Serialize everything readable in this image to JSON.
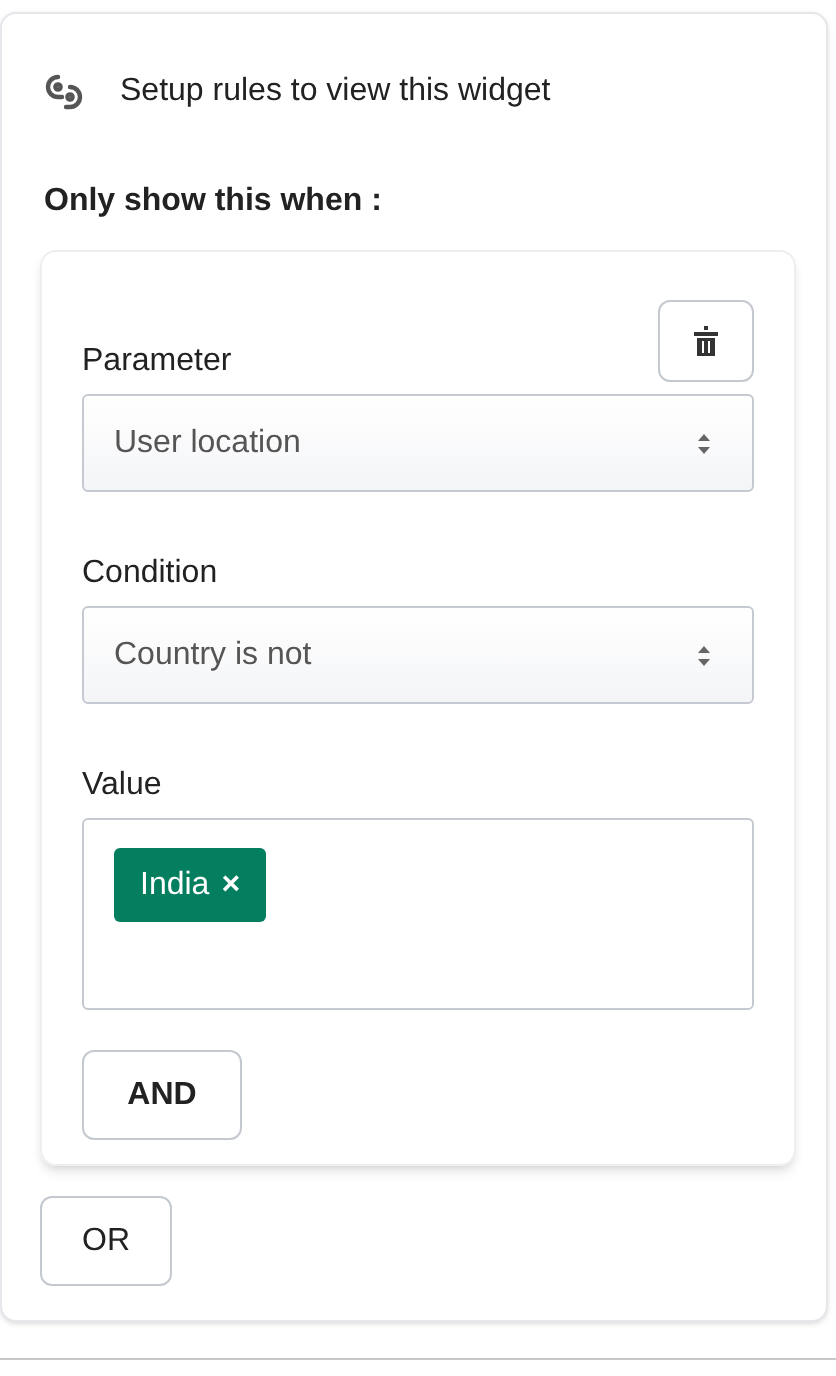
{
  "header": {
    "title": "Setup rules to view this widget"
  },
  "heading": "Only show this when :",
  "rule": {
    "fields": [
      {
        "kind": "select",
        "label": "Parameter",
        "value": "User location"
      },
      {
        "kind": "select",
        "label": "Condition",
        "value": "Country is not"
      },
      {
        "kind": "tags",
        "label": "Value",
        "tags": [
          {
            "text": "India",
            "remove": "×"
          }
        ]
      }
    ],
    "and_button": "AND"
  },
  "or_button": "OR"
}
